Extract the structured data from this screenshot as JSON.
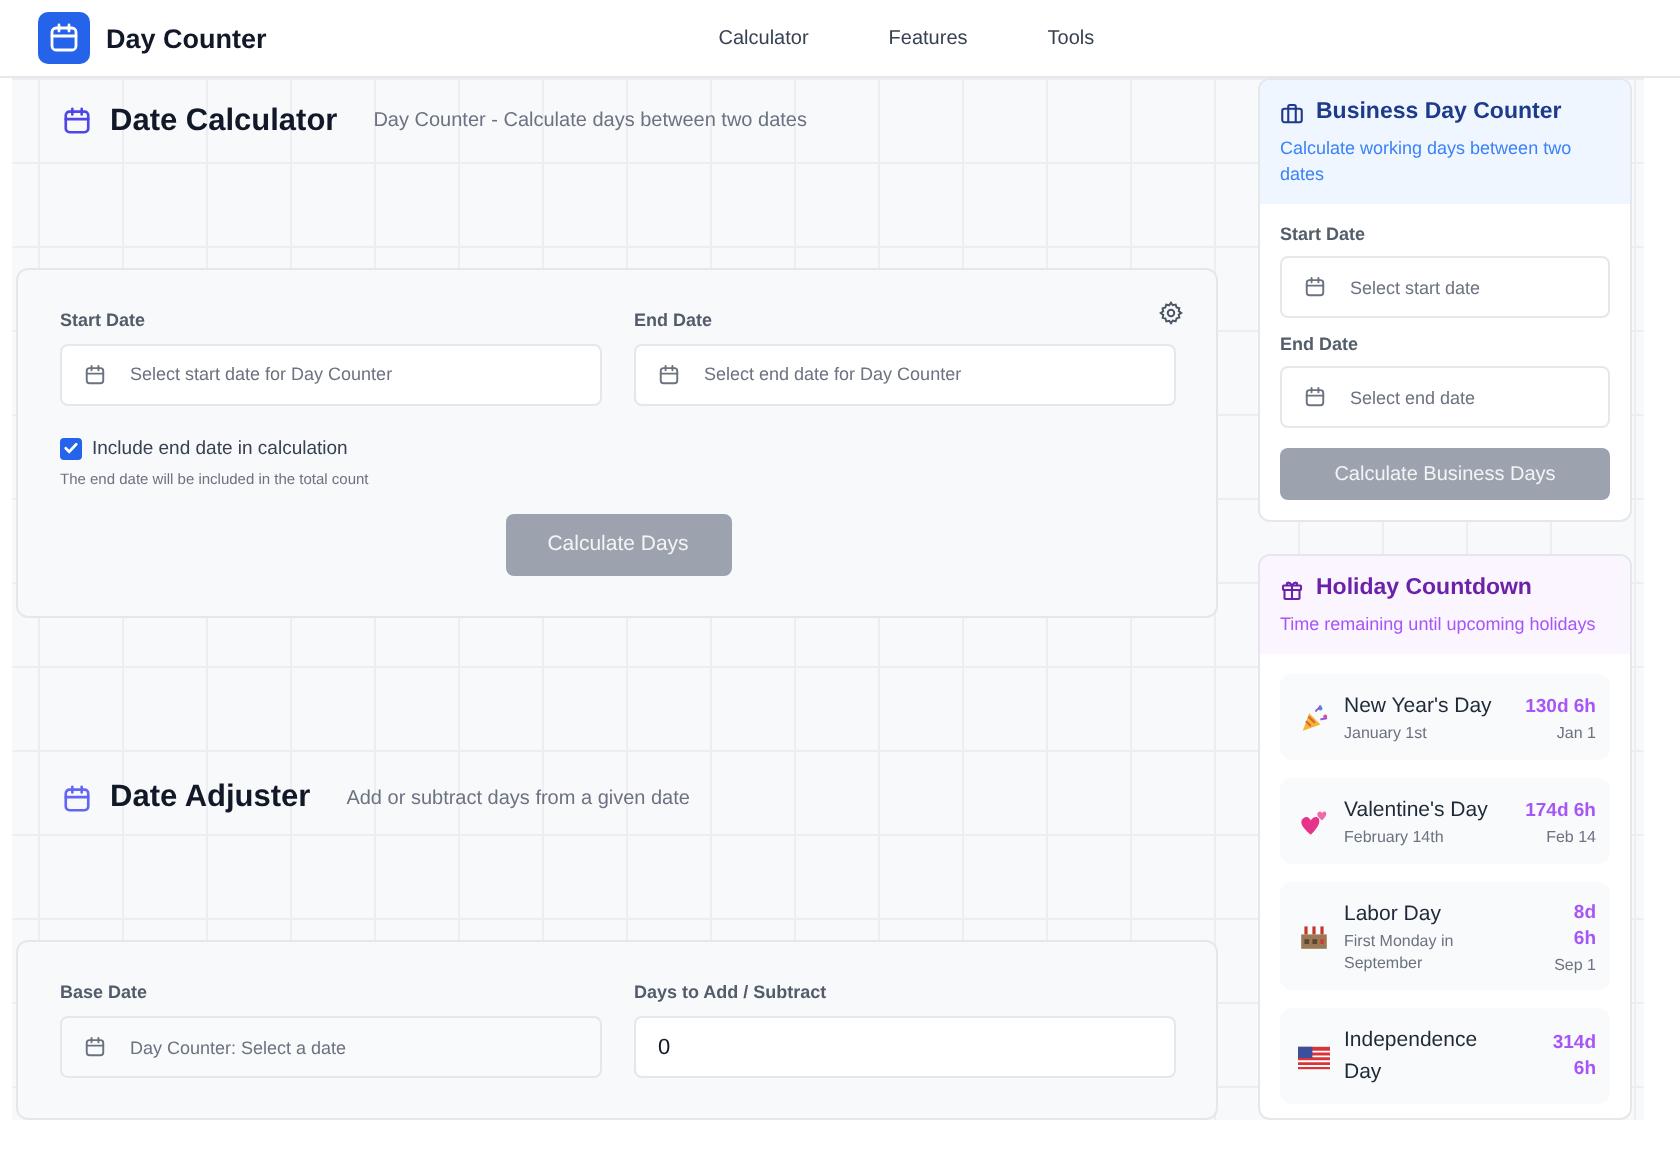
{
  "header": {
    "app_name": "Day Counter",
    "nav": [
      "Calculator",
      "Features",
      "Tools"
    ]
  },
  "calculator": {
    "title": "Date Calculator",
    "subtitle": "Day Counter - Calculate days between two dates",
    "fields": [
      {
        "label": "Start Date",
        "placeholder": "Select start date for Day Counter"
      },
      {
        "label": "End Date",
        "placeholder": "Select end date for Day Counter"
      }
    ],
    "include_end": {
      "label": "Include end date in calculation",
      "checked": true,
      "hint": "The end date will be included in the total count"
    },
    "button": {
      "label": "Calculate Days",
      "disabled": true
    }
  },
  "adjuster": {
    "title": "Date Adjuster",
    "subtitle": "Add or subtract days from a given date",
    "base_date": {
      "label": "Base Date",
      "placeholder": "Day Counter: Select a date"
    },
    "days": {
      "label": "Days to Add / Subtract",
      "value": "0"
    }
  },
  "business": {
    "title": "Business Day Counter",
    "subtitle": "Calculate working days between two dates",
    "fields": [
      {
        "label": "Start Date",
        "placeholder": "Select start date"
      },
      {
        "label": "End Date",
        "placeholder": "Select end date"
      }
    ],
    "button": {
      "label": "Calculate Business Days",
      "disabled": true
    }
  },
  "holidays": {
    "title": "Holiday Countdown",
    "subtitle": "Time remaining until upcoming holidays",
    "items": [
      {
        "name": "New Year's Day",
        "date": "January 1st",
        "countdown": "130d 6h",
        "short_date": "Jan 1"
      },
      {
        "name": "Valentine's Day",
        "date": "February 14th",
        "countdown": "174d 6h",
        "short_date": "Feb 14"
      },
      {
        "name": "Labor Day",
        "date": "First Monday in September",
        "countdown": "8d 6h",
        "short_date": "Sep 1"
      },
      {
        "name": "Independence Day",
        "countdown": "314d 6h"
      }
    ]
  }
}
